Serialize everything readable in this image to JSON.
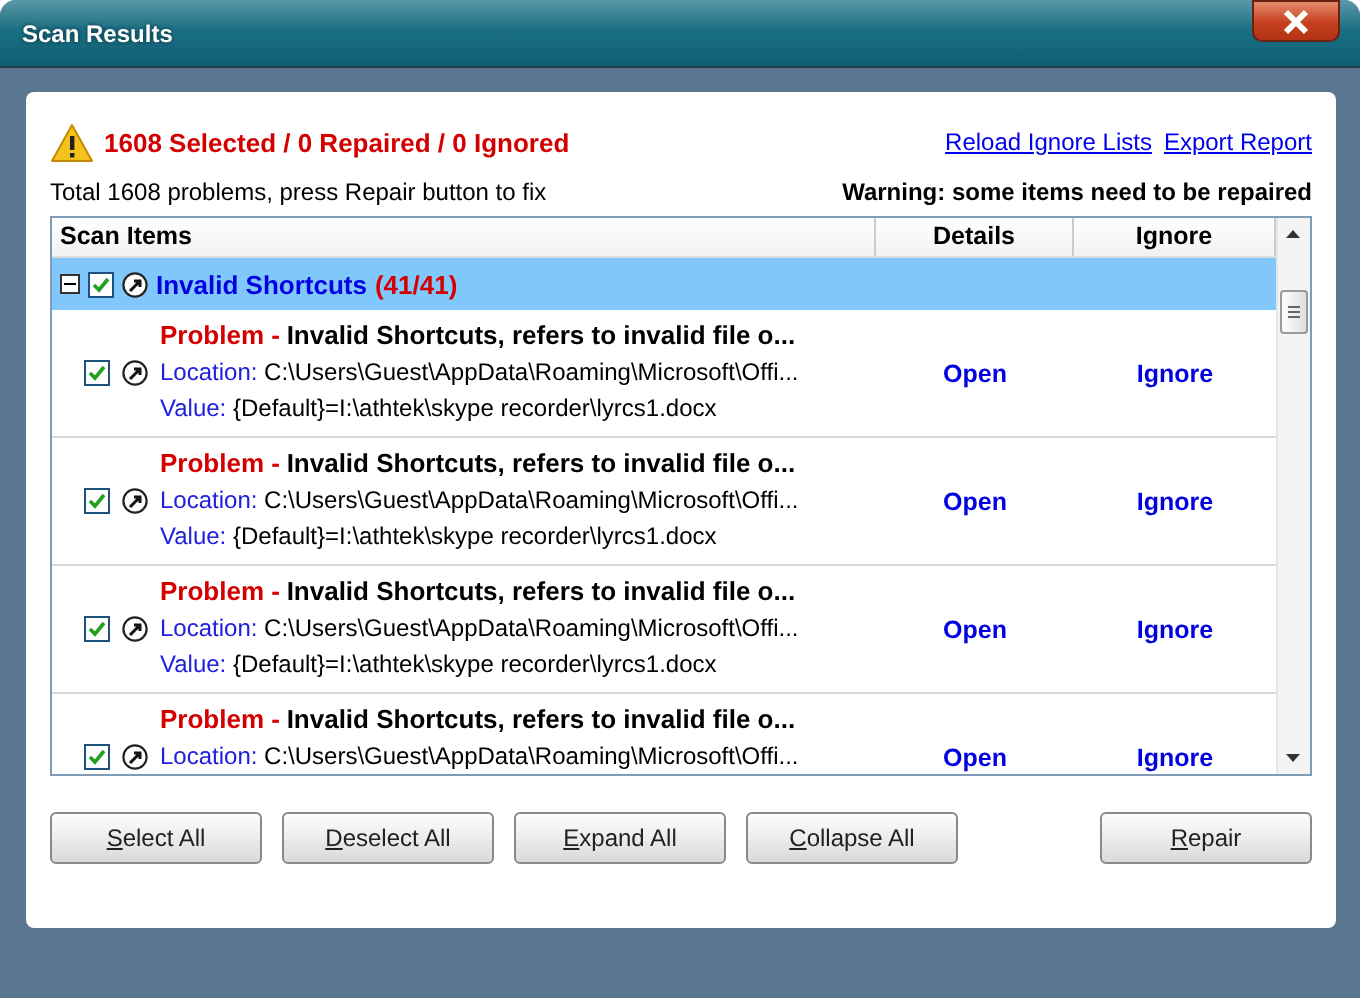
{
  "window": {
    "title": "Scan Results"
  },
  "summary": {
    "status": "1608 Selected / 0 Repaired / 0 Ignored",
    "hint": "Total 1608 problems, press Repair button to fix",
    "warning": "Warning: some items need to be repaired"
  },
  "links": [
    "Reload Ignore Lists",
    "Export Report"
  ],
  "table": {
    "columns": [
      "Scan Items",
      "Details",
      "Ignore"
    ],
    "groups": [
      {
        "name": "Invalid Shortcuts",
        "count": "(41/41)",
        "expanded": true,
        "checked": true,
        "selected": true,
        "items": [
          {
            "checked": true,
            "problem_label": "Problem -",
            "problem": "Invalid Shortcuts, refers to invalid file o...",
            "location_label": "Location:",
            "location": "C:\\Users\\Guest\\AppData\\Roaming\\Microsoft\\Offi...",
            "value_label": "Value:",
            "value": "{Default}=I:\\athtek\\skype recorder\\lyrcs1.docx",
            "details": "Open",
            "ignore": "Ignore"
          },
          {
            "checked": true,
            "problem_label": "Problem -",
            "problem": "Invalid Shortcuts, refers to invalid file o...",
            "location_label": "Location:",
            "location": "C:\\Users\\Guest\\AppData\\Roaming\\Microsoft\\Offi...",
            "value_label": "Value:",
            "value": "{Default}=I:\\athtek\\skype recorder\\lyrcs1.docx",
            "details": "Open",
            "ignore": "Ignore"
          },
          {
            "checked": true,
            "problem_label": "Problem -",
            "problem": "Invalid Shortcuts, refers to invalid file o...",
            "location_label": "Location:",
            "location": "C:\\Users\\Guest\\AppData\\Roaming\\Microsoft\\Offi...",
            "value_label": "Value:",
            "value": "{Default}=I:\\athtek\\skype recorder\\lyrcs1.docx",
            "details": "Open",
            "ignore": "Ignore"
          },
          {
            "checked": true,
            "problem_label": "Problem -",
            "problem": "Invalid Shortcuts, refers to invalid file o...",
            "location_label": "Location:",
            "location": "C:\\Users\\Guest\\AppData\\Roaming\\Microsoft\\Offi...",
            "details": "Open",
            "ignore": "Ignore"
          }
        ]
      }
    ]
  },
  "buttons": [
    {
      "label": "Select All"
    },
    {
      "label": "Deselect All"
    },
    {
      "label": "Expand All"
    },
    {
      "label": "Collapse All"
    }
  ],
  "repair_button": "Repair"
}
